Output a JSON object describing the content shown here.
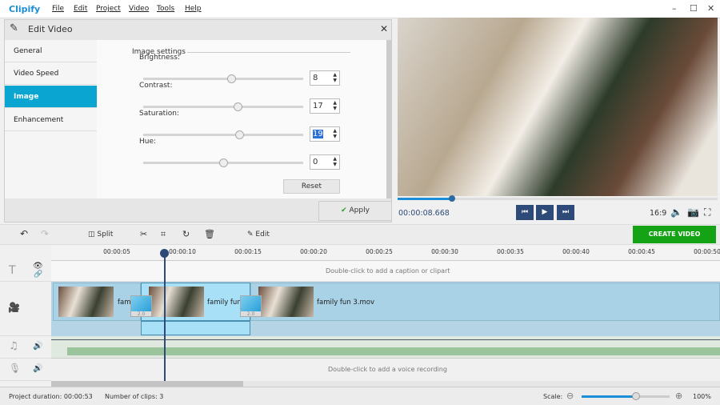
{
  "app": {
    "title": "Clipify",
    "menu": [
      "File",
      "Edit",
      "Project",
      "Video",
      "Tools",
      "Help"
    ]
  },
  "edit_panel": {
    "title": "Edit Video",
    "nav": [
      "General",
      "Video Speed",
      "Image",
      "Enhancement"
    ],
    "active_nav": "Image",
    "section": "Image settings",
    "sliders": [
      {
        "label": "Brightness:",
        "value": "8",
        "level": 0.55
      },
      {
        "label": "Contrast:",
        "value": "17",
        "level": 0.59
      },
      {
        "label": "Saturation:",
        "value": "19",
        "level": 0.6
      },
      {
        "label": "Hue:",
        "value": "0",
        "level": 0.5
      }
    ],
    "reset": "Reset",
    "apply": "Apply"
  },
  "player": {
    "time": "00:00:08.668",
    "aspect": "16:9",
    "progress": 0.17,
    "accent": "#1a8fd8"
  },
  "toolbar": {
    "split": "Split",
    "edit": "Edit",
    "create": "CREATE VIDEO",
    "create_color": "#14a314"
  },
  "ruler": [
    "00:00:05",
    "00:00:10",
    "00:00:15",
    "00:00:20",
    "00:00:25",
    "00:00:30",
    "00:00:35",
    "00:00:40",
    "00:00:45",
    "00:00:50"
  ],
  "timeline": {
    "caption_hint": "Double-click to add a caption or clipart",
    "voice_hint": "Double-click to add a voice recording",
    "clips": [
      "fam",
      "family fun",
      "family fun 3.mov"
    ],
    "transition": "2.0"
  },
  "status": {
    "duration": "Project duration:  00:00:53",
    "clips": "Number of clips: 3",
    "scale": "Scale:",
    "zoom": "100%",
    "scale_level": 0.62
  }
}
